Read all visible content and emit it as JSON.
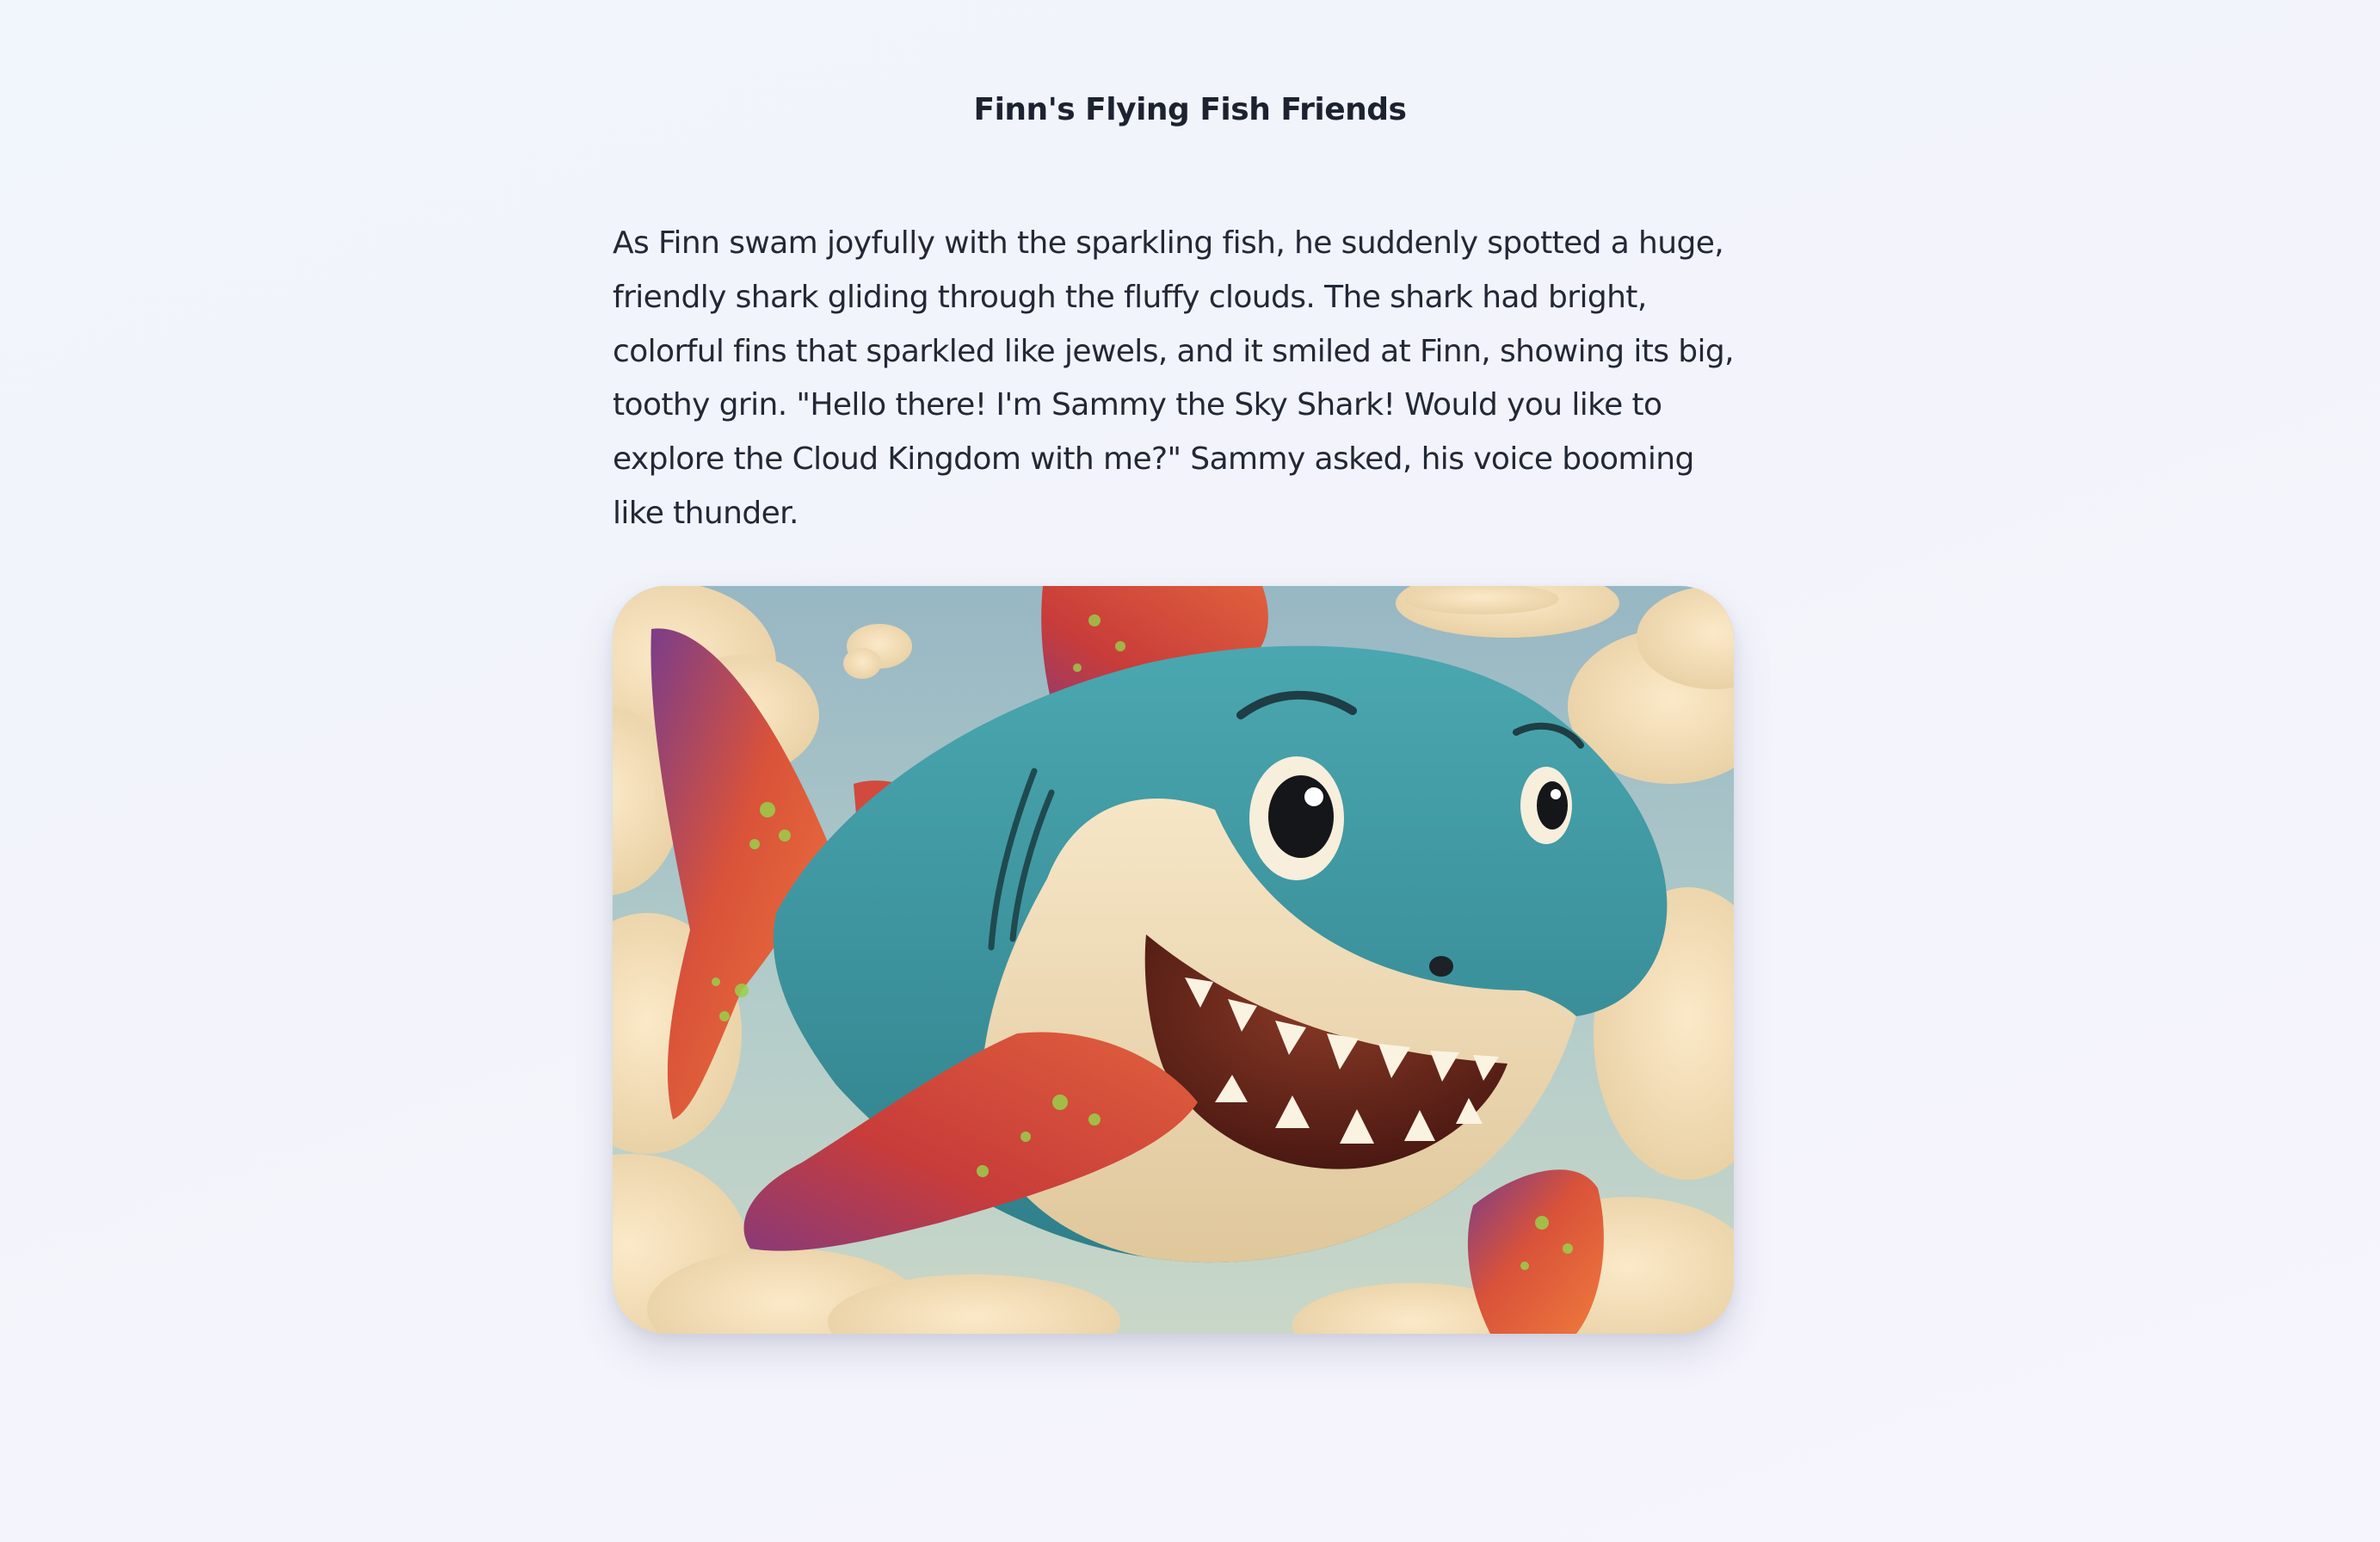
{
  "page": {
    "title": "Finn's Flying Fish Friends"
  },
  "story": {
    "paragraph": "As Finn swam joyfully with the sparkling fish, he suddenly spotted a huge, friendly shark gliding through the fluffy clouds. The shark had bright, colorful fins that sparkled like jewels, and it smiled at Finn, showing its big, toothy grin. \"Hello there! I'm Sammy the Sky Shark! Would you like to explore the Cloud Kingdom with me?\" Sammy asked, his voice booming like thunder."
  },
  "illustration": {
    "subject": "smiling-sky-shark",
    "colors": {
      "sky": "#a9c6cc",
      "clouds": "#f5dcb4",
      "shark_body": "#3f9aa3",
      "shark_belly": "#f0dcb8",
      "fin_red": "#d8553c",
      "fin_purple": "#7a3f86",
      "fin_green": "#9ad04a",
      "mouth": "#5a1f17"
    }
  }
}
